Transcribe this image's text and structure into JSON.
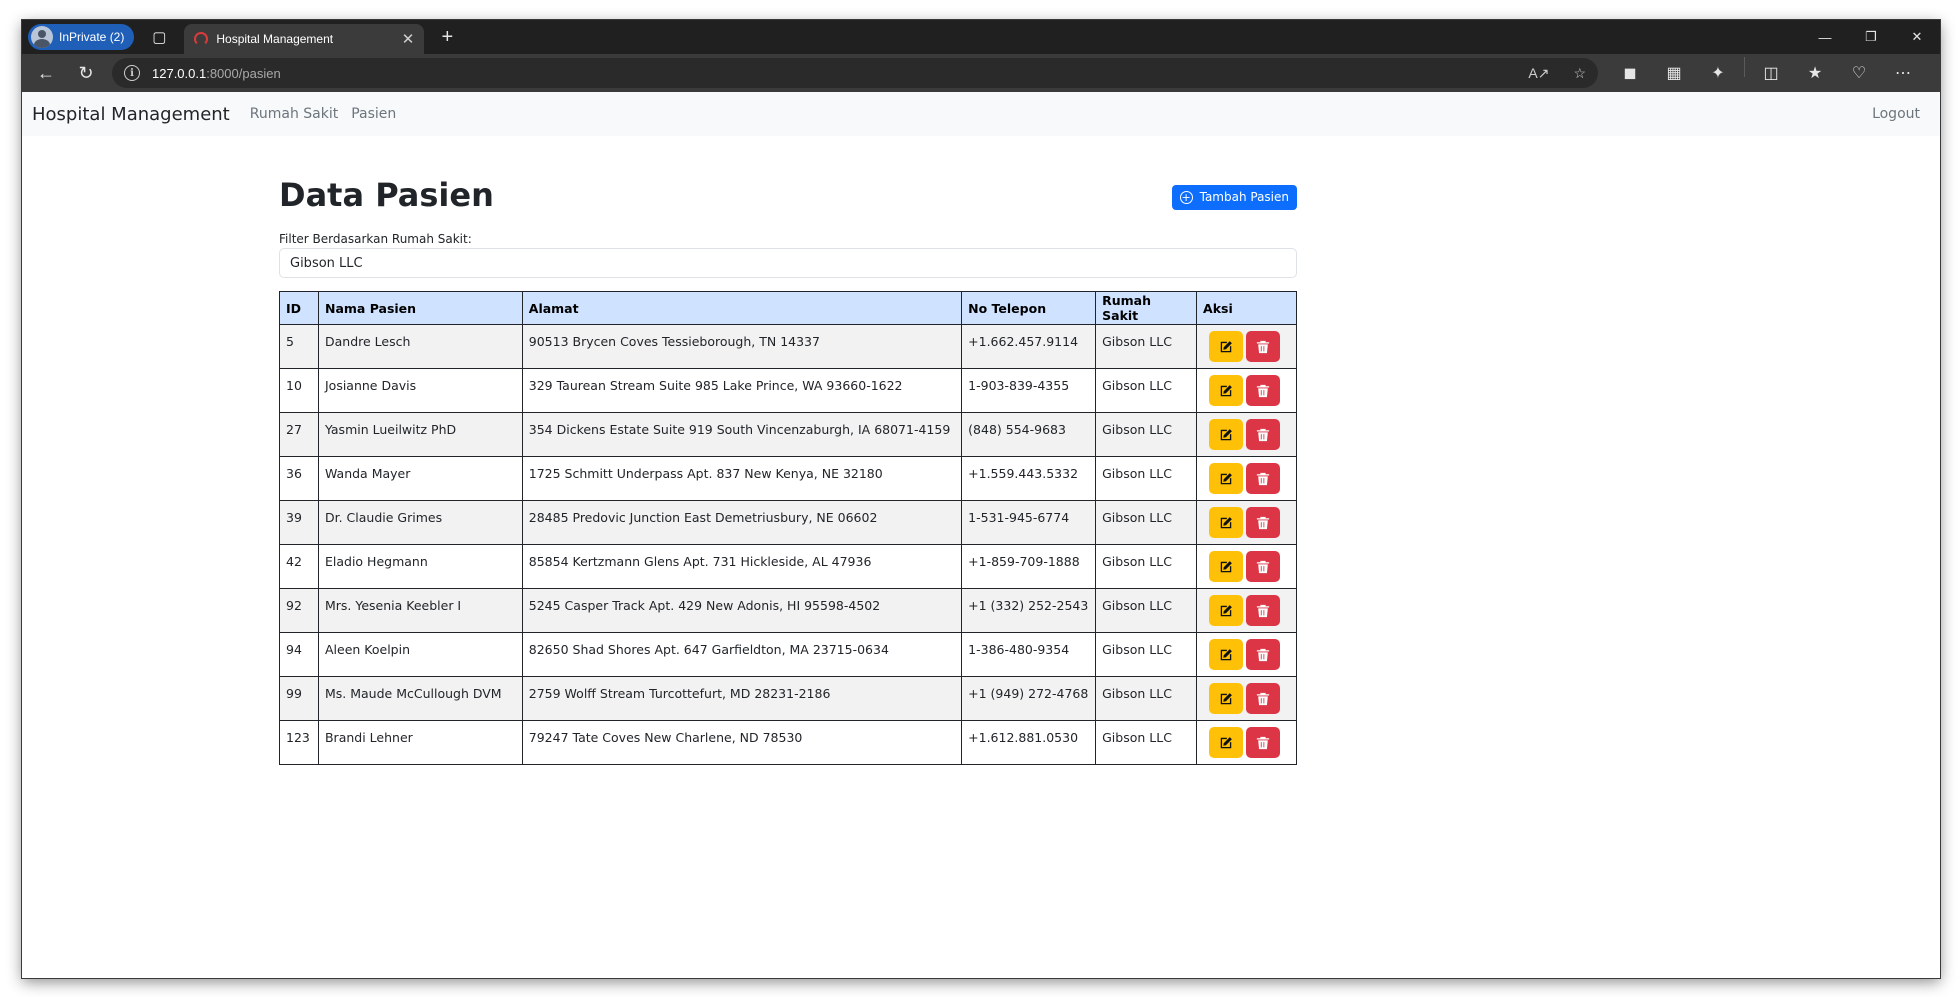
{
  "browser": {
    "profile_label": "InPrivate (2)",
    "tab_title": "Hospital Management",
    "url_host": "127.0.0.1",
    "url_path": ":8000/pasien",
    "icons": [
      "workspaces-icon",
      "new-tab-icon",
      "back-icon",
      "refresh-icon",
      "info-icon",
      "read-aloud-icon",
      "favorite-star-icon",
      "extension-icon",
      "split-screen-icon",
      "favorites-icon",
      "health-icon",
      "more-icon"
    ]
  },
  "navbar": {
    "brand": "Hospital Management",
    "links": [
      "Rumah Sakit",
      "Pasien"
    ],
    "logout": "Logout"
  },
  "main": {
    "title": "Data Pasien",
    "add_button": "Tambah Pasien",
    "filter_label": "Filter Berdasarkan Rumah Sakit:",
    "filter_value": "Gibson LLC"
  },
  "table": {
    "headers": [
      "ID",
      "Nama Pasien",
      "Alamat",
      "No Telepon",
      "Rumah Sakit",
      "Aksi"
    ],
    "rows": [
      [
        "5",
        "Dandre Lesch",
        "90513 Brycen Coves Tessieborough, TN 14337",
        "+1.662.457.9114",
        "Gibson LLC"
      ],
      [
        "10",
        "Josianne Davis",
        "329 Taurean Stream Suite 985 Lake Prince, WA 93660-1622",
        "1-903-839-4355",
        "Gibson LLC"
      ],
      [
        "27",
        "Yasmin Lueilwitz PhD",
        "354 Dickens Estate Suite 919 South Vincenzaburgh, IA 68071-4159",
        "(848) 554-9683",
        "Gibson LLC"
      ],
      [
        "36",
        "Wanda Mayer",
        "1725 Schmitt Underpass Apt. 837 New Kenya, NE 32180",
        "+1.559.443.5332",
        "Gibson LLC"
      ],
      [
        "39",
        "Dr. Claudie Grimes",
        "28485 Predovic Junction East Demetriusbury, NE 06602",
        "1-531-945-6774",
        "Gibson LLC"
      ],
      [
        "42",
        "Eladio Hegmann",
        "85854 Kertzmann Glens Apt. 731 Hickleside, AL 47936",
        "+1-859-709-1888",
        "Gibson LLC"
      ],
      [
        "92",
        "Mrs. Yesenia Keebler I",
        "5245 Casper Track Apt. 429 New Adonis, HI 95598-4502",
        "+1 (332) 252-2543",
        "Gibson LLC"
      ],
      [
        "94",
        "Aleen Koelpin",
        "82650 Shad Shores Apt. 647 Garfieldton, MA 23715-0634",
        "1-386-480-9354",
        "Gibson LLC"
      ],
      [
        "99",
        "Ms. Maude McCullough DVM",
        "2759 Wolff Stream Turcottefurt, MD 28231-2186",
        "+1 (949) 272-4768",
        "Gibson LLC"
      ],
      [
        "123",
        "Brandi Lehner",
        "79247 Tate Coves New Charlene, ND 78530",
        "+1.612.881.0530",
        "Gibson LLC"
      ]
    ]
  },
  "colors": {
    "primary": "#0d6efd",
    "warning": "#ffc107",
    "danger": "#dc3545",
    "table_header": "#cfe2ff"
  }
}
